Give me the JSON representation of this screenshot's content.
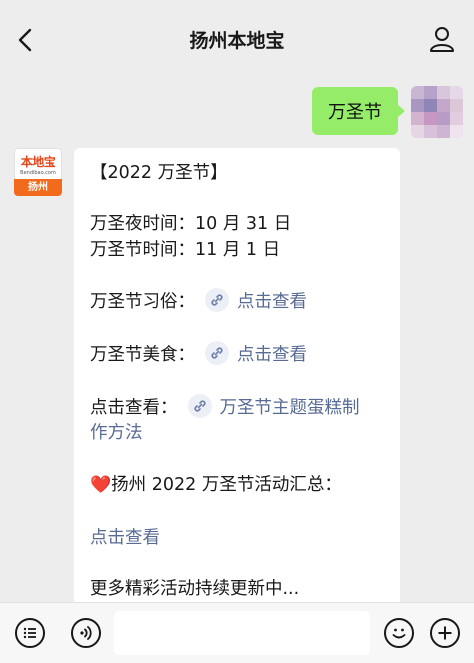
{
  "header": {
    "title": "扬州本地宝"
  },
  "icons": {
    "back": "chevron-left-icon",
    "profile": "person-icon",
    "menu": "list-menu-icon",
    "voice": "voice-icon",
    "emoji": "smiley-icon",
    "add": "plus-icon",
    "mini_program": "link-icon"
  },
  "user_message": {
    "text": "万圣节"
  },
  "bot_avatar": {
    "logo_text": "本地宝",
    "logo_sub": "Bendibao.com",
    "city": "扬州"
  },
  "bot_message": {
    "heading": "【2022 万圣节】",
    "eve_label": "万圣夜时间：",
    "eve_date": "10 月 31 日",
    "day_label": "万圣节时间：",
    "day_date": "11 月 1 日",
    "customs_label": "万圣节习俗：",
    "customs_link": "点击查看",
    "food_label": "万圣节美食：",
    "food_link": "点击查看",
    "cake_label": "点击查看：",
    "cake_link_line1": "万圣节主题蛋糕制",
    "cake_link_line2": "作方法",
    "events_heart": "❤️",
    "events_label": "扬州 2022 万圣节活动汇总：",
    "events_link": "点击查看",
    "more_text": "更多精彩活动持续更新中..."
  },
  "colors": {
    "background": "#ededed",
    "user_bubble": "#95ec69",
    "bot_bubble": "#ffffff",
    "link": "#576b95",
    "brand_orange": "#f26a1b"
  }
}
